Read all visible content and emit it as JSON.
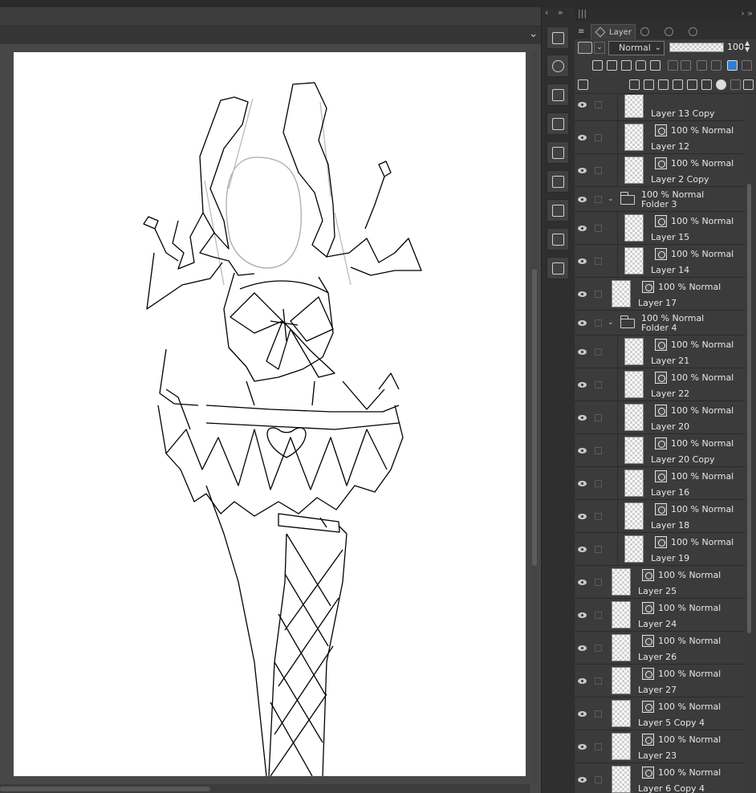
{
  "panel": {
    "tab_label": "Layer",
    "blend_mode": "Normal",
    "opacity_value": "100",
    "opacity_fraction": 1.0
  },
  "layers": [
    {
      "type": "layer",
      "level": 1,
      "meta": "",
      "name": "Layer 13 Copy",
      "partial": true
    },
    {
      "type": "layer",
      "level": 1,
      "meta": "100 % Normal",
      "name": "Layer 12"
    },
    {
      "type": "layer",
      "level": 1,
      "meta": "100 % Normal",
      "name": "Layer 2 Copy"
    },
    {
      "type": "folder",
      "level": 0,
      "meta": "100 % Normal",
      "name": "Folder 3"
    },
    {
      "type": "layer",
      "level": 1,
      "meta": "100 % Normal",
      "name": "Layer 15"
    },
    {
      "type": "layer",
      "level": 1,
      "meta": "100 % Normal",
      "name": "Layer 14"
    },
    {
      "type": "layer",
      "level": 0,
      "meta": "100 % Normal",
      "name": "Layer 17"
    },
    {
      "type": "folder",
      "level": 0,
      "meta": "100 % Normal",
      "name": "Folder 4"
    },
    {
      "type": "layer",
      "level": 1,
      "meta": "100 % Normal",
      "name": "Layer 21"
    },
    {
      "type": "layer",
      "level": 1,
      "meta": "100 % Normal",
      "name": "Layer 22"
    },
    {
      "type": "layer",
      "level": 1,
      "meta": "100 % Normal",
      "name": "Layer 20"
    },
    {
      "type": "layer",
      "level": 1,
      "meta": "100 % Normal",
      "name": "Layer 20 Copy"
    },
    {
      "type": "layer",
      "level": 1,
      "meta": "100 % Normal",
      "name": "Layer 16"
    },
    {
      "type": "layer",
      "level": 1,
      "meta": "100 % Normal",
      "name": "Layer 18"
    },
    {
      "type": "layer",
      "level": 1,
      "meta": "100 % Normal",
      "name": "Layer 19"
    },
    {
      "type": "layer",
      "level": 0,
      "meta": "100 % Normal",
      "name": "Layer 25"
    },
    {
      "type": "layer",
      "level": 0,
      "meta": "100 % Normal",
      "name": "Layer 24"
    },
    {
      "type": "layer",
      "level": 0,
      "meta": "100 % Normal",
      "name": "Layer 26"
    },
    {
      "type": "layer",
      "level": 0,
      "meta": "100 % Normal",
      "name": "Layer 27"
    },
    {
      "type": "layer",
      "level": 0,
      "meta": "100 % Normal",
      "name": "Layer 5 Copy 4"
    },
    {
      "type": "layer",
      "level": 0,
      "meta": "100 % Normal",
      "name": "Layer 23"
    },
    {
      "type": "layer",
      "level": 0,
      "meta": "100 % Normal",
      "name": "Layer 6 Copy 4"
    }
  ],
  "tools": [
    {
      "icon": "grid-palette-icon"
    },
    {
      "icon": "navigator-icon"
    },
    {
      "icon": "grid-palette-icon"
    },
    {
      "icon": "material-icon"
    },
    {
      "icon": "timeline-icon"
    },
    {
      "icon": "layer-property-icon"
    },
    {
      "icon": "transform-icon"
    },
    {
      "icon": "grid-palette-icon"
    },
    {
      "icon": "transform-icon"
    }
  ],
  "colors": {
    "panel_bg": "#3b3b3b",
    "canvas_bg": "#474747",
    "paper": "#ffffff",
    "text": "#e6e6e6",
    "accent": "#2f7fd1"
  }
}
